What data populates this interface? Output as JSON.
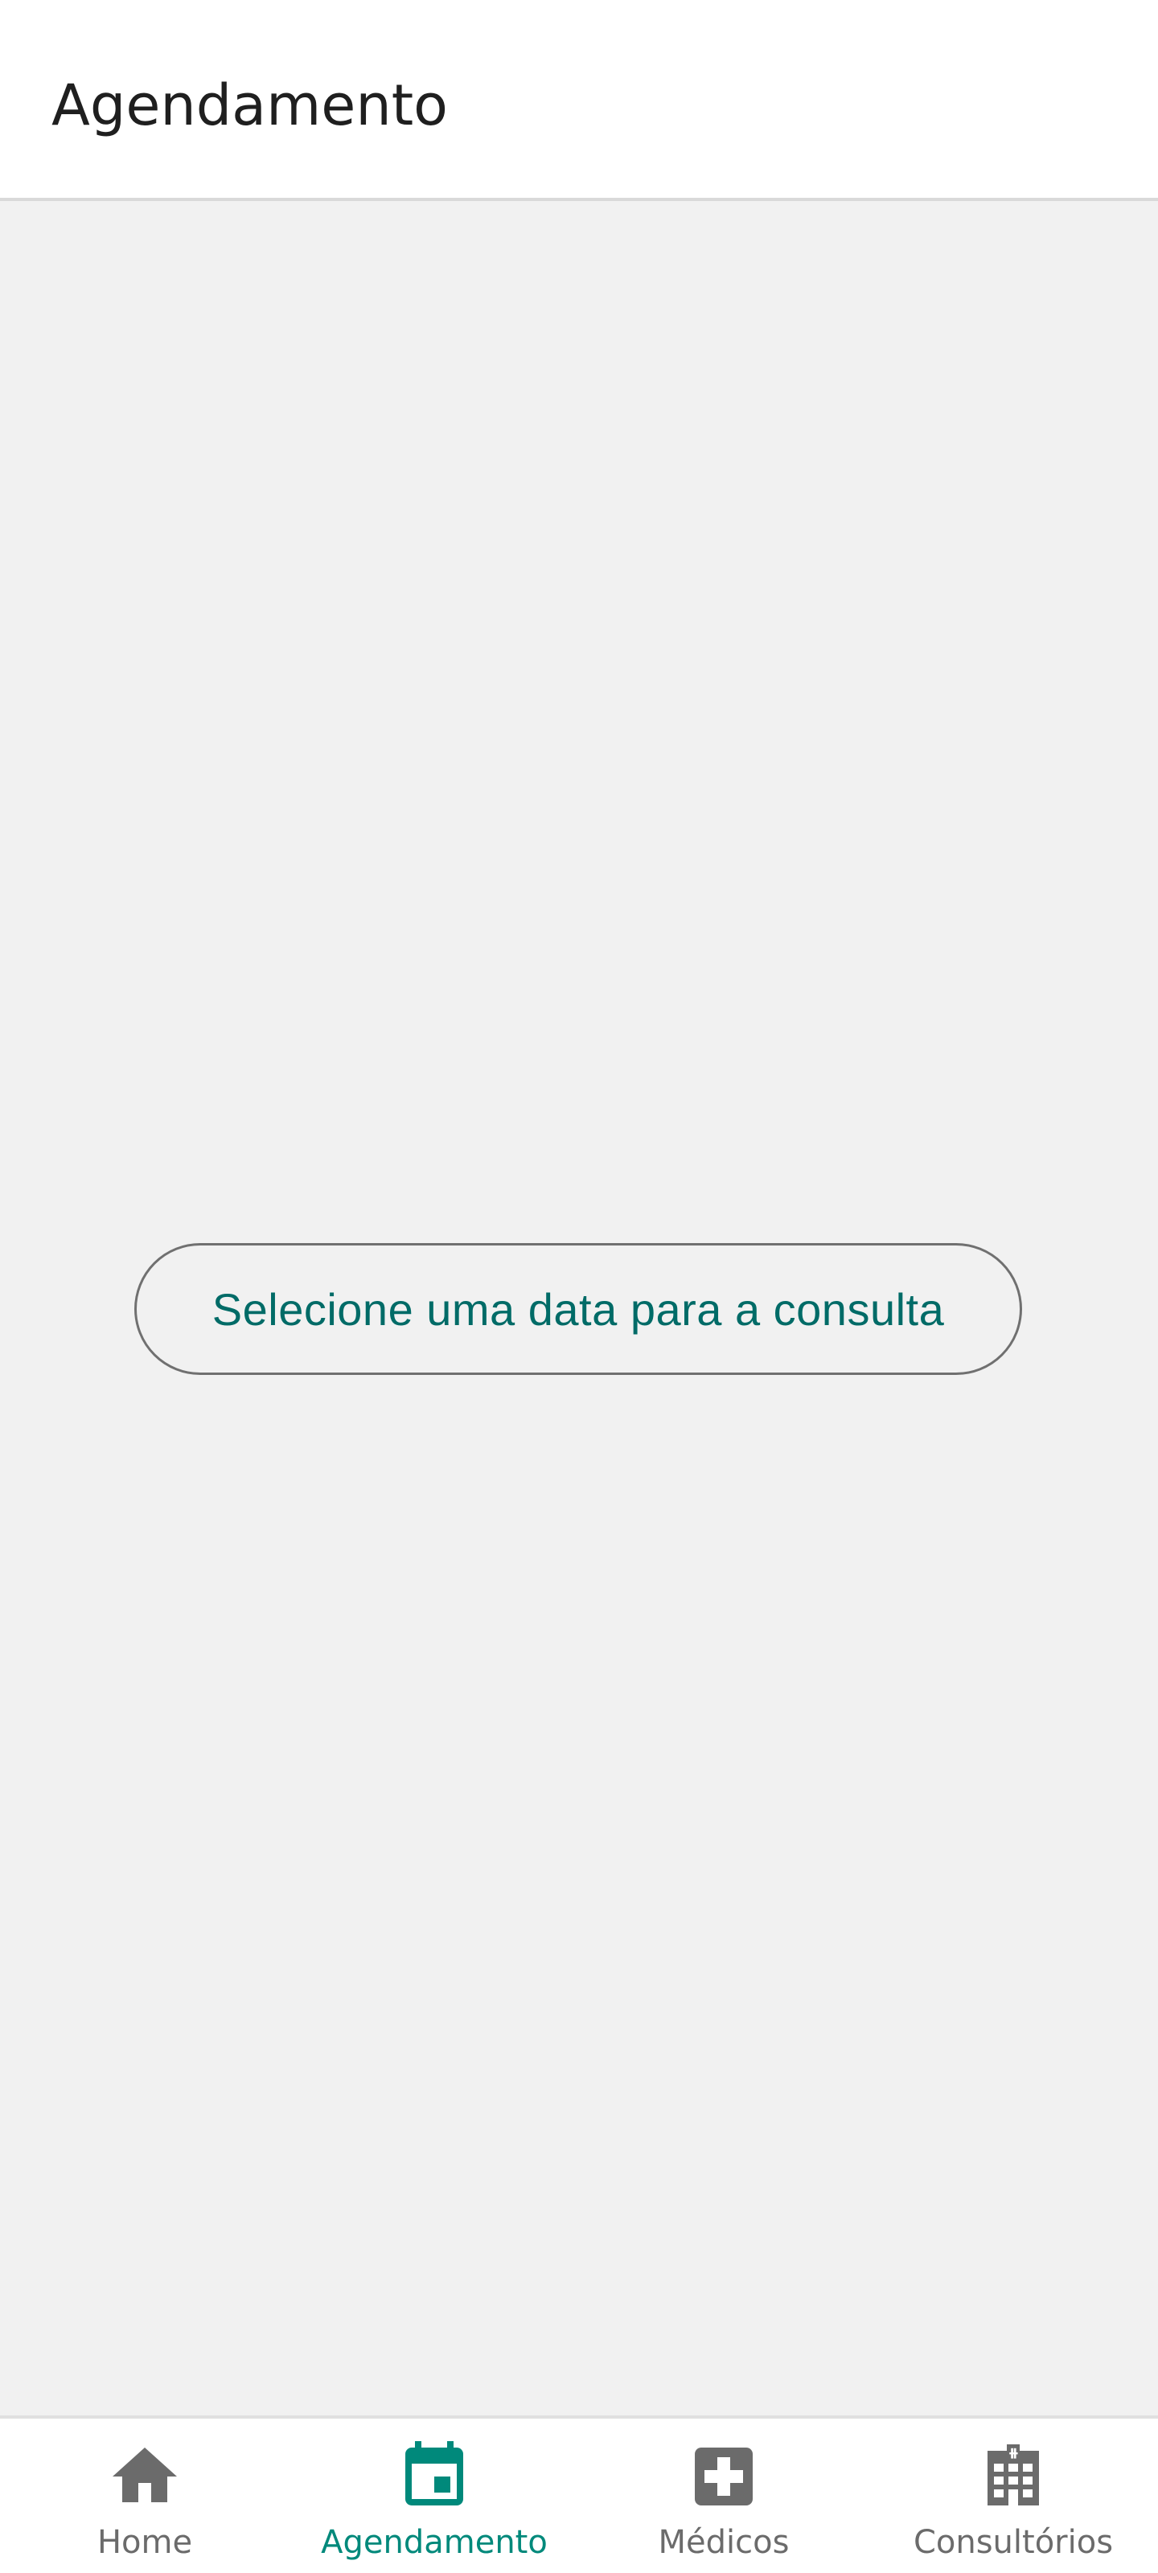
{
  "header": {
    "title": "Agendamento"
  },
  "main": {
    "date_button_label": "Selecione uma data para a consulta"
  },
  "bottom_nav": {
    "active_color": "#00897b",
    "inactive_color": "#6b6b6b",
    "items": [
      {
        "label": "Home",
        "icon": "home-icon",
        "active": false
      },
      {
        "label": "Agendamento",
        "icon": "calendar-icon",
        "active": true
      },
      {
        "label": "Médicos",
        "icon": "medical-cross-icon",
        "active": false
      },
      {
        "label": "Consultórios",
        "icon": "hospital-building-icon",
        "active": false
      }
    ]
  }
}
